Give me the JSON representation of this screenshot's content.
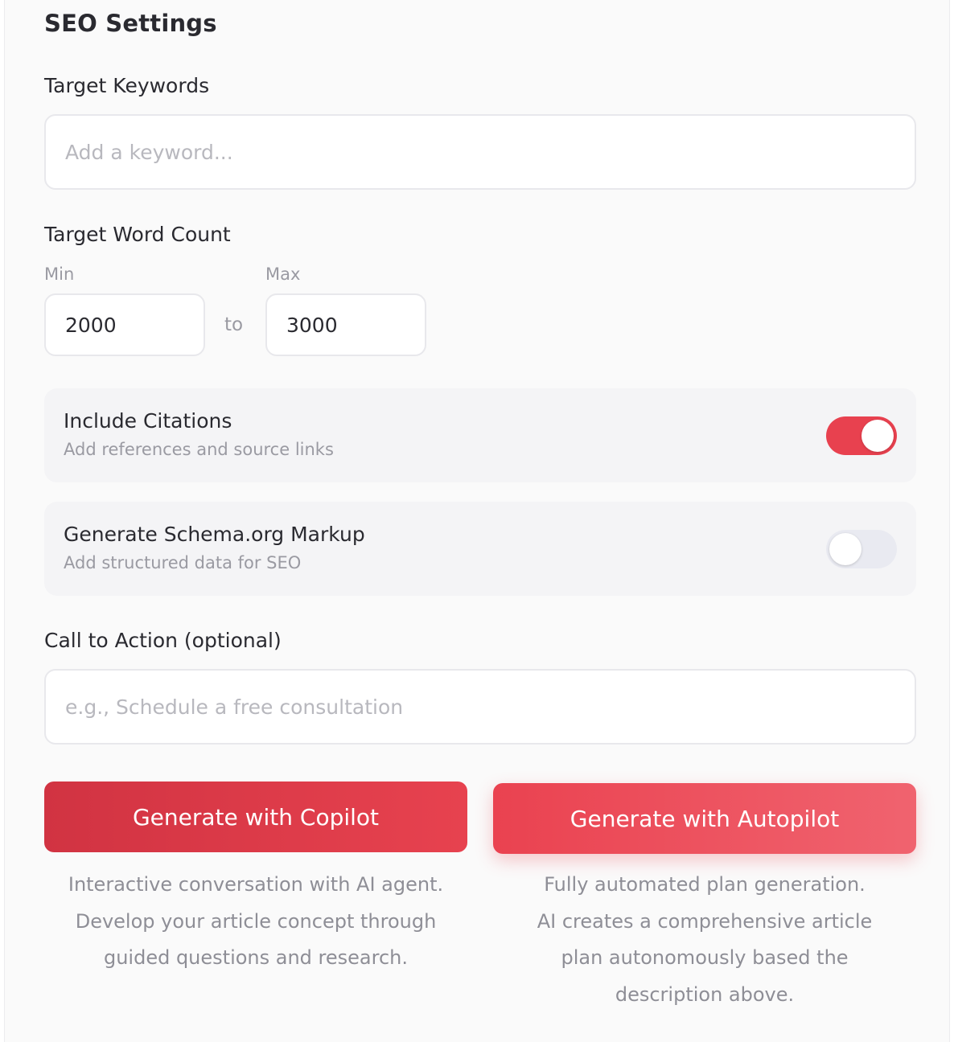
{
  "seo": {
    "section_title": "SEO Settings",
    "keywords": {
      "label": "Target Keywords",
      "placeholder": "Add a keyword...",
      "value": ""
    },
    "word_count": {
      "label": "Target Word Count",
      "min_label": "Min",
      "min_value": "2000",
      "separator": "to",
      "max_label": "Max",
      "max_value": "3000"
    },
    "citations": {
      "title": "Include Citations",
      "description": "Add references and source links",
      "enabled": true
    },
    "schema": {
      "title": "Generate Schema.org Markup",
      "description": "Add structured data for SEO",
      "enabled": false
    },
    "cta": {
      "label": "Call to Action (optional)",
      "placeholder": "e.g., Schedule a free consultation",
      "value": ""
    }
  },
  "actions": {
    "copilot": {
      "label": "Generate with Copilot",
      "description_lines": [
        "Interactive conversation with AI agent.",
        "Develop your article concept through",
        "guided questions and research."
      ]
    },
    "autopilot": {
      "label": "Generate with Autopilot",
      "description_lines": [
        "Fully automated plan generation.",
        "AI creates a comprehensive article",
        "plan autonomously based the",
        "description above."
      ]
    }
  },
  "colors": {
    "accent": "#e8414f",
    "accent_dark": "#d13342",
    "toggle_off": "#e9eaf1"
  }
}
